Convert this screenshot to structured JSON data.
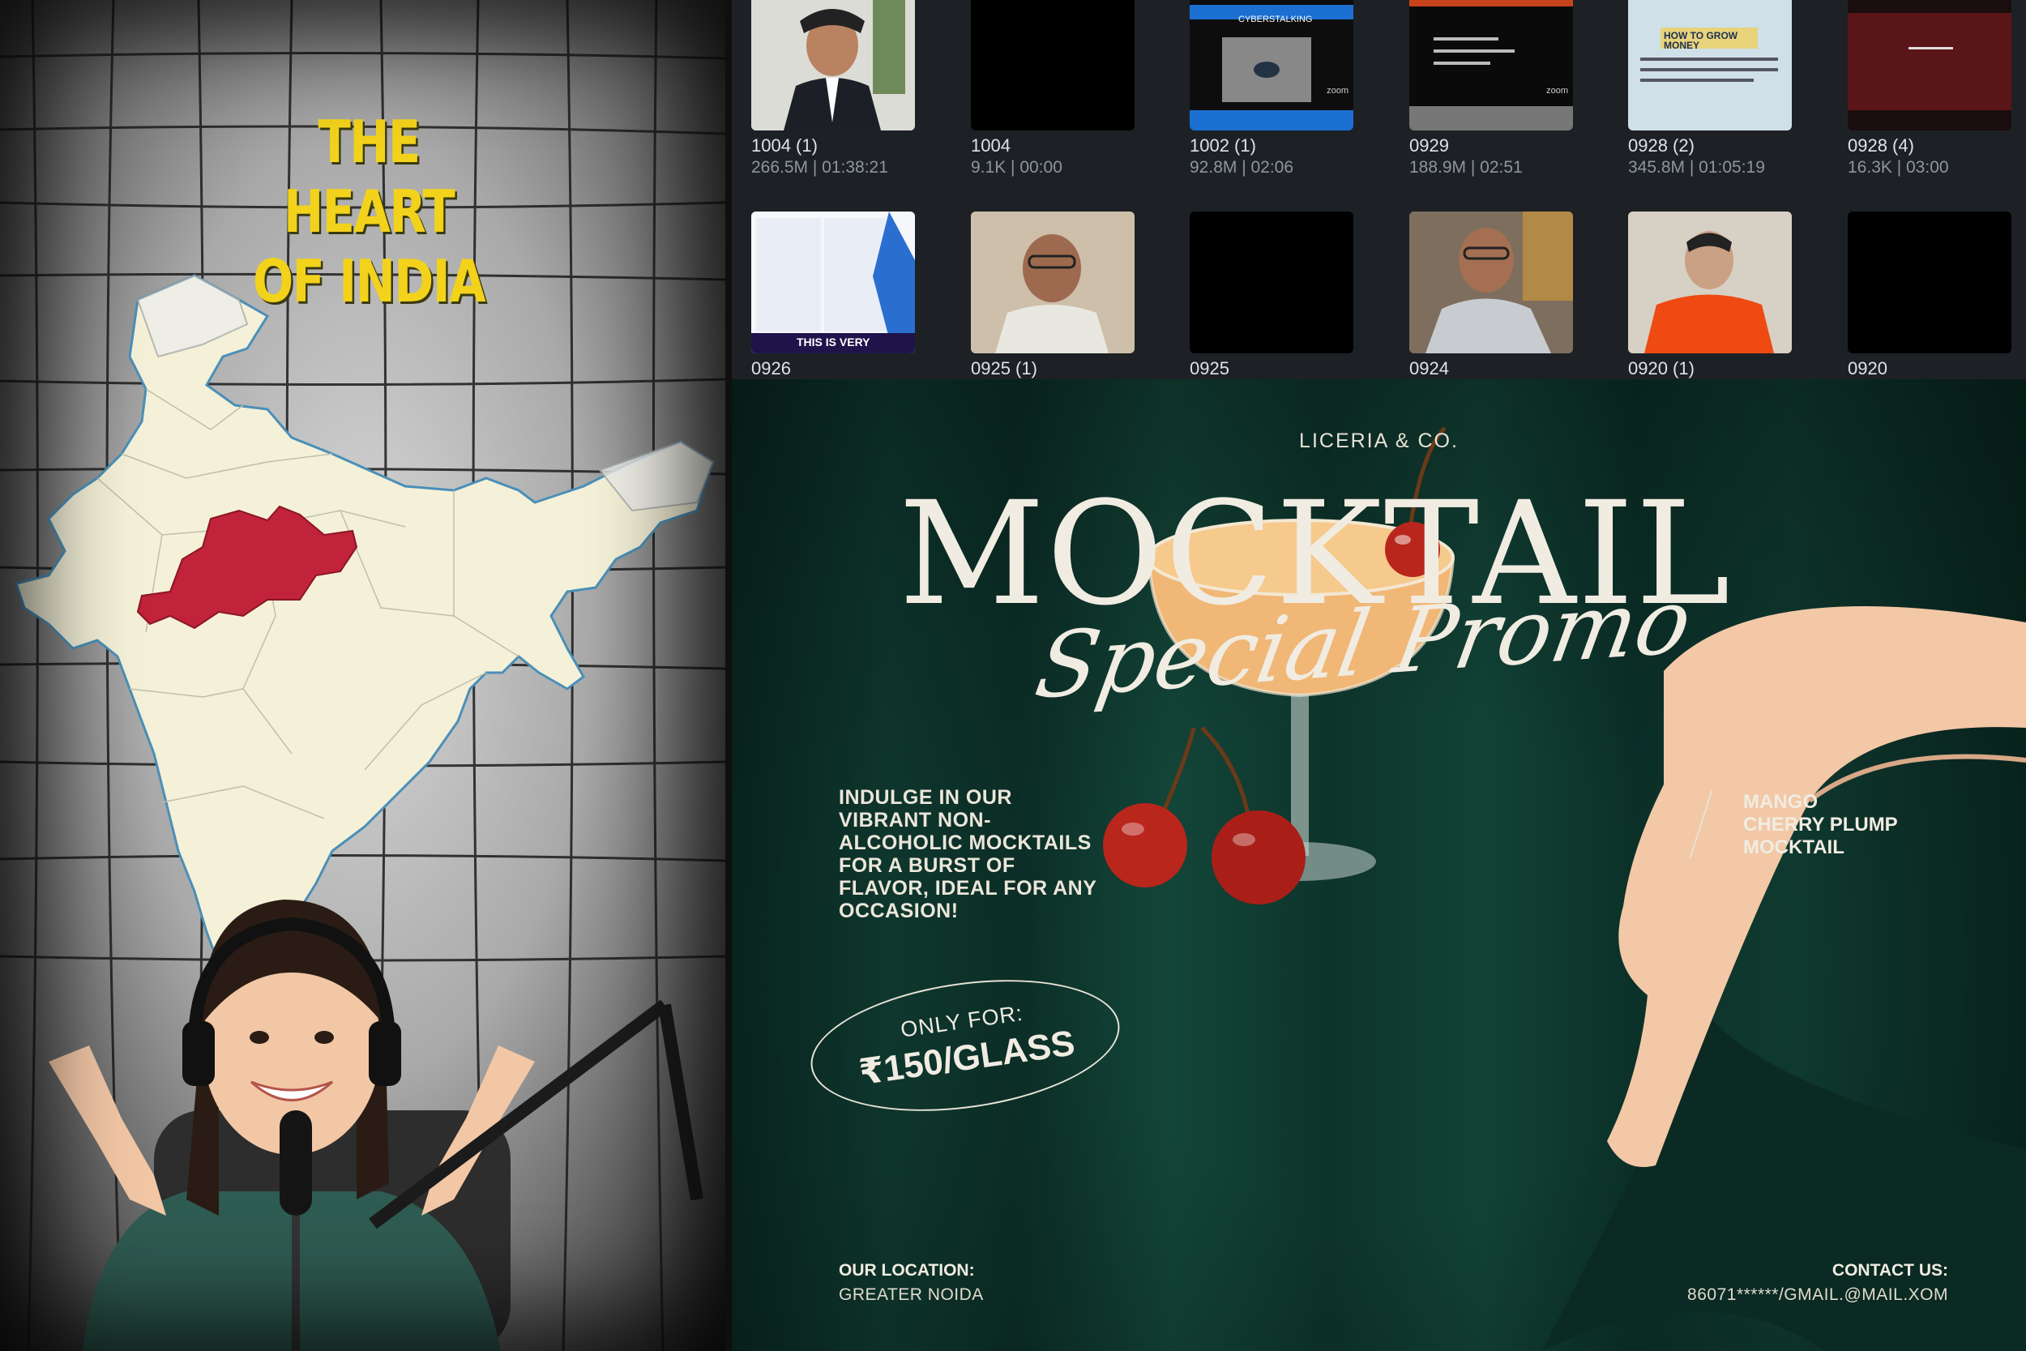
{
  "left_poster": {
    "title_line1": "THE HEART",
    "title_line2": "OF INDIA",
    "highlight_color": "#c0233a",
    "title_color": "#f2d21b"
  },
  "file_grid": {
    "row1": [
      {
        "name": "1004 (1)",
        "meta": "266.5M | 01:38:21"
      },
      {
        "name": "1004",
        "meta": "9.1K | 00:00"
      },
      {
        "name": "1002 (1)",
        "meta": "92.8M | 02:06"
      },
      {
        "name": "0929",
        "meta": "188.9M | 02:51"
      },
      {
        "name": "0928 (2)",
        "meta": "345.8M | 01:05:19"
      },
      {
        "name": "0928 (4)",
        "meta": "16.3K | 03:00"
      }
    ],
    "row2": [
      {
        "name": "0926"
      },
      {
        "name": "0925 (1)"
      },
      {
        "name": "0925"
      },
      {
        "name": "0924"
      },
      {
        "name": "0920 (1)"
      },
      {
        "name": "0920"
      }
    ],
    "thumb_texts": {
      "cyberstalking": "CYBERSTALKING",
      "zoom": "zoom",
      "grow_money": "HOW TO GROW MONEY",
      "this_is_very": "THIS IS VERY"
    }
  },
  "promo": {
    "brand": "LICERIA & CO.",
    "headline": "MOCKTAIL",
    "script": "Special Promo",
    "description": "INDULGE IN OUR VIBRANT NON-ALCOHOLIC MOCKTAILS FOR A BURST OF FLAVOR, IDEAL FOR ANY OCCASION!",
    "price_label": "ONLY FOR:",
    "price": "₹150/GLASS",
    "product_line1": "MANGO",
    "product_line2": "CHERRY PLUMP",
    "product_line3": "MOCKTAIL",
    "location_label": "OUR LOCATION:",
    "location": "GREATER NOIDA",
    "contact_label": "CONTACT US:",
    "contact": "86071******/GMAIL.@MAIL.XOM",
    "drink_color": "#f0b777",
    "cherry_color": "#b8261c"
  }
}
